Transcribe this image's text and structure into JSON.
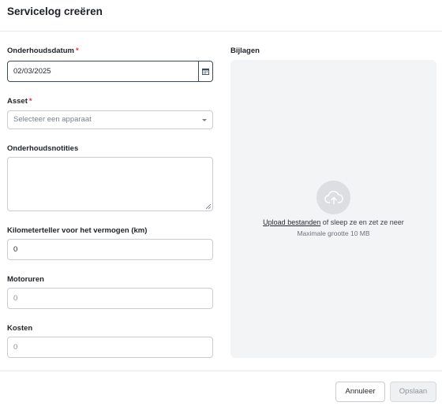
{
  "dialog": {
    "title": "Servicelog creëren"
  },
  "form": {
    "date": {
      "label": "Onderhoudsdatum",
      "required_mark": "*",
      "value": "02/03/2025"
    },
    "asset": {
      "label": "Asset",
      "required_mark": "*",
      "placeholder": "Selecteer een apparaat"
    },
    "notes": {
      "label": "Onderhoudsnotities",
      "value": ""
    },
    "odometer": {
      "label": "Kilometerteller voor het vermogen (km)",
      "value": "0"
    },
    "engine_hours": {
      "label": "Motoruren",
      "placeholder": "0"
    },
    "cost": {
      "label": "Kosten",
      "placeholder": "0"
    }
  },
  "attachments": {
    "label": "Bijlagen",
    "upload_link": "Upload bestanden",
    "upload_rest": " of sleep ze en zet ze neer",
    "max_size": "Maximale grootte 10 MB",
    "icon": "cloud-upload-icon"
  },
  "footer": {
    "cancel_label": "Annuleer",
    "save_label": "Opslaan"
  },
  "colors": {
    "required": "#d9363e",
    "dropzone_bg": "#f3f4f5"
  }
}
